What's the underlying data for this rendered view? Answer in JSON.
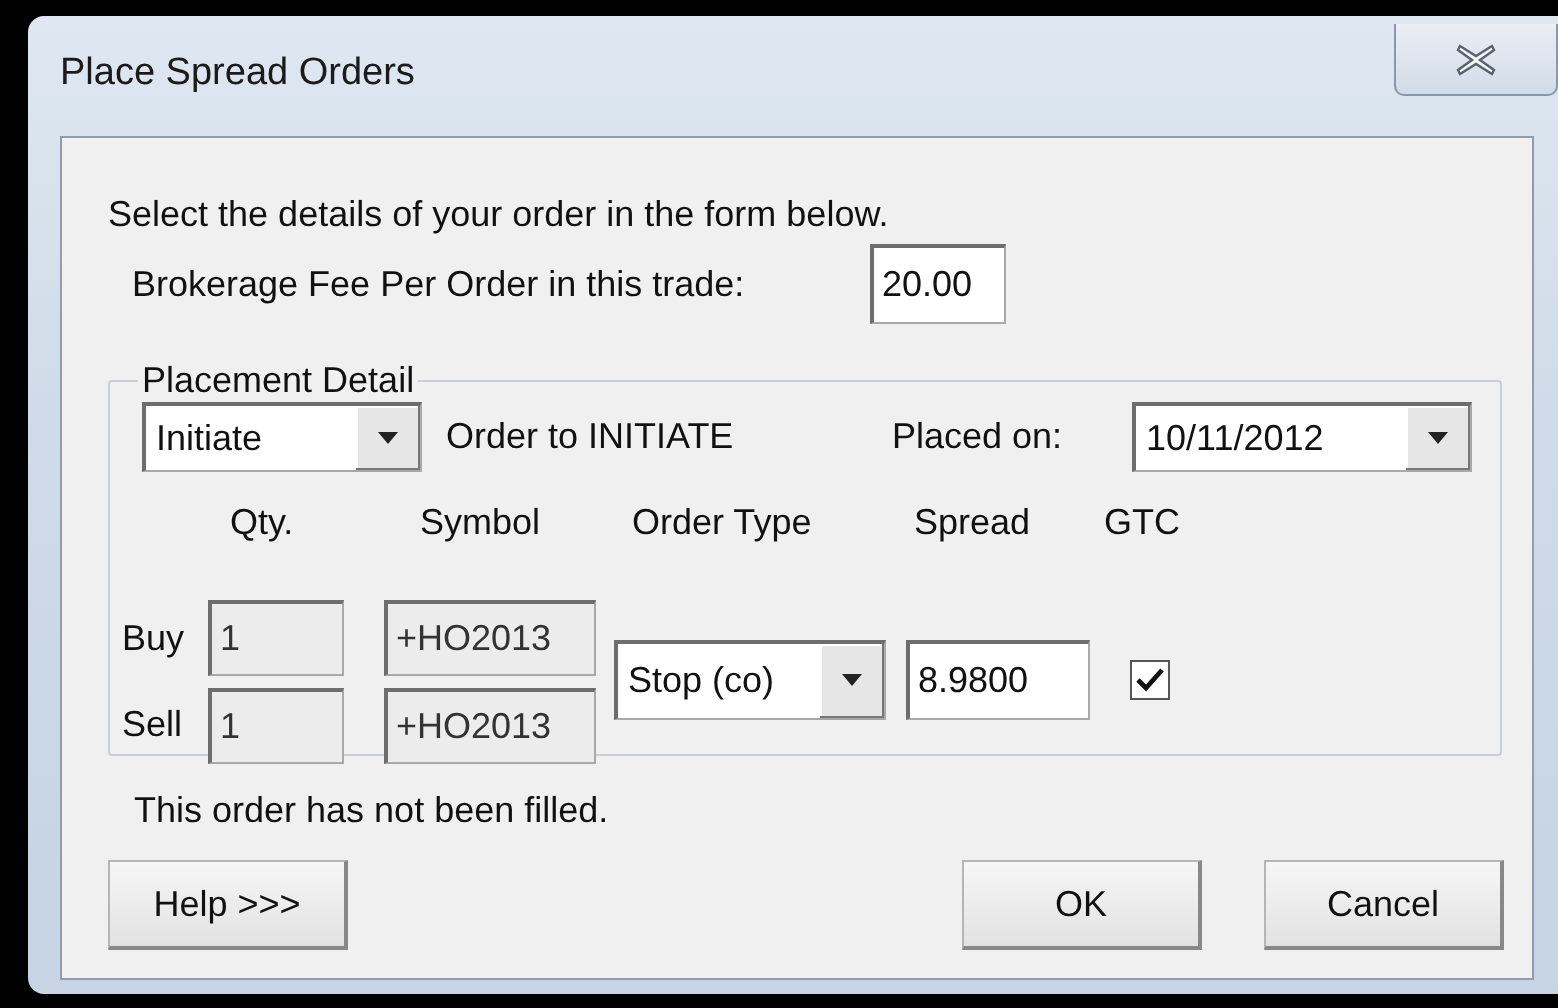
{
  "window": {
    "title": "Place Spread Orders"
  },
  "instruction": "Select the details of your order in the form below.",
  "brokerage_fee": {
    "label": "Brokerage Fee Per Order in this trade:",
    "value": "20.00"
  },
  "placement_detail": {
    "legend": "Placement Detail",
    "action": {
      "value": "Initiate"
    },
    "action_text": "Order to INITIATE",
    "placed_on": {
      "label": "Placed on:",
      "value": "10/11/2012"
    },
    "columns": [
      "Qty.",
      "Symbol",
      "Order Type",
      "Spread",
      "GTC"
    ],
    "rows": [
      {
        "label": "Buy",
        "qty": {
          "value": "1",
          "disabled": true
        },
        "symbol": {
          "value": "+HO2013",
          "disabled": true
        }
      },
      {
        "label": "Sell",
        "qty": {
          "value": "1",
          "disabled": true
        },
        "symbol": {
          "value": "+HO2013",
          "disabled": true
        }
      }
    ],
    "order_type": {
      "value": "Stop (co)"
    },
    "spread": {
      "value": "8.9800"
    },
    "gtc": {
      "checked": true
    }
  },
  "status": "This order has not been filled.",
  "buttons": [
    {
      "label": "Help >>>",
      "kind": "left"
    },
    {
      "label": "OK",
      "kind": "right"
    },
    {
      "label": "Cancel",
      "kind": "right"
    }
  ]
}
